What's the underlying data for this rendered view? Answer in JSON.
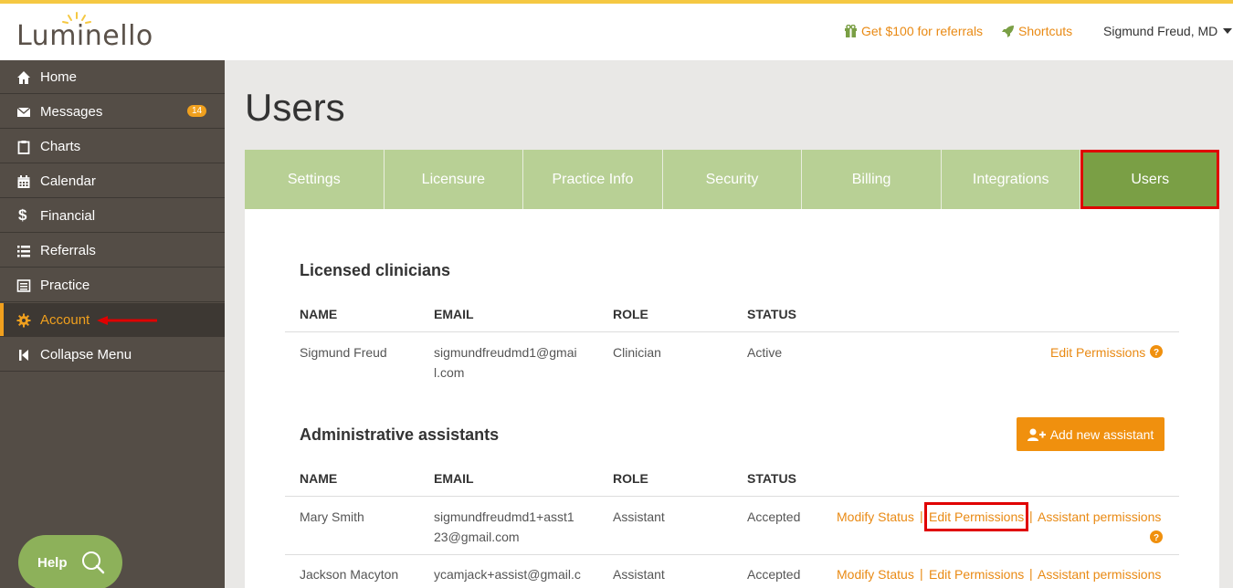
{
  "header": {
    "logo": "Luminello",
    "referral_link": "Get $100 for referrals",
    "shortcuts_link": "Shortcuts",
    "user_name": "Sigmund Freud, MD"
  },
  "sidebar": {
    "items": [
      {
        "label": "Home",
        "icon": "home-icon"
      },
      {
        "label": "Messages",
        "icon": "envelope-icon",
        "badge": "14"
      },
      {
        "label": "Charts",
        "icon": "clipboard-icon"
      },
      {
        "label": "Calendar",
        "icon": "calendar-icon"
      },
      {
        "label": "Financial",
        "icon": "dollar-icon"
      },
      {
        "label": "Referrals",
        "icon": "list-icon"
      },
      {
        "label": "Practice",
        "icon": "notebook-icon"
      },
      {
        "label": "Account",
        "icon": "gear-icon",
        "active": true
      },
      {
        "label": "Collapse Menu",
        "icon": "collapse-icon"
      }
    ],
    "help_label": "Help"
  },
  "page": {
    "title": "Users",
    "tabs": [
      "Settings",
      "Licensure",
      "Practice Info",
      "Security",
      "Billing",
      "Integrations",
      "Users"
    ],
    "active_tab": "Users"
  },
  "clinicians": {
    "title": "Licensed clinicians",
    "columns": [
      "NAME",
      "EMAIL",
      "ROLE",
      "STATUS"
    ],
    "rows": [
      {
        "name": "Sigmund Freud",
        "email_line1": "sigmundfreudmd1@gmai",
        "email_line2": "l.com",
        "role": "Clinician",
        "status": "Active",
        "action": "Edit Permissions"
      }
    ]
  },
  "assistants": {
    "title": "Administrative assistants",
    "add_button": "Add new assistant",
    "columns": [
      "NAME",
      "EMAIL",
      "ROLE",
      "STATUS"
    ],
    "rows": [
      {
        "name": "Mary Smith",
        "email_line1": "sigmundfreudmd1+asst1",
        "email_line2": "23@gmail.com",
        "role": "Assistant",
        "status": "Accepted",
        "modify": "Modify Status",
        "edit": "Edit Permissions",
        "assistant_perms": "Assistant permissions"
      },
      {
        "name": "Jackson Macyton",
        "email_line1": "ycamjack+assist@gmail.c",
        "role": "Assistant",
        "status": "Accepted",
        "modify": "Modify Status",
        "edit": "Edit Permissions",
        "assistant_perms": "Assistant permissions"
      }
    ]
  },
  "colors": {
    "accent_orange": "#f0900e",
    "tab_green": "#b8d095",
    "tab_active_green": "#7a9f45",
    "sidebar_bg": "#544d46",
    "highlight_red": "#e00000"
  }
}
